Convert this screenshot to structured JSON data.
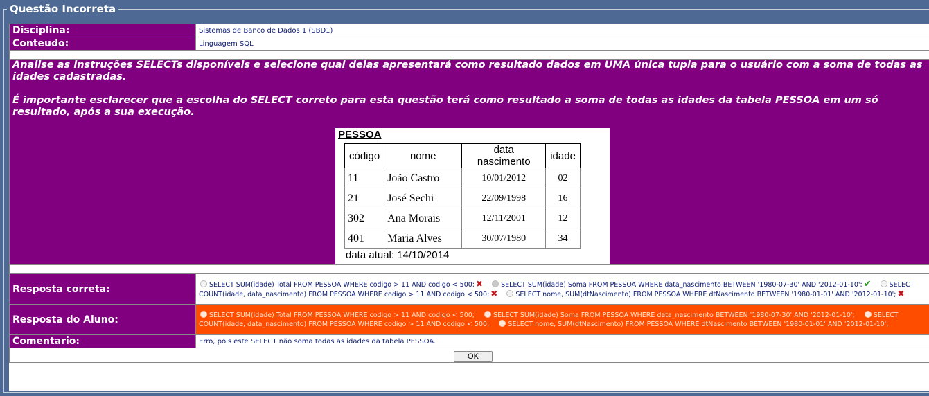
{
  "legend": "Questão Incorreta",
  "disciplina": {
    "label": "Disciplina:",
    "value": "Sistemas de Banco de Dados 1 (SBD1)"
  },
  "conteudo": {
    "label": "Conteudo:",
    "value": "Linguagem SQL"
  },
  "enunciado": {
    "p1": "Analise as instruções SELECTs disponíveis e selecione qual delas apresentará como resultado dados em UMA única tupla para o usuário com a soma de todas as idades cadastradas.",
    "p2": "É importante esclarecer que a escolha do SELECT correto para esta questão terá como resultado a soma de todas as idades da tabela PESSOA em um só resultado, após a sua execução."
  },
  "figura": {
    "titulo": "PESSOA",
    "headers": [
      "código",
      "nome",
      "data nascimento",
      "idade"
    ],
    "rows": [
      [
        "11",
        "João Castro",
        "10/01/2012",
        "02"
      ],
      [
        "21",
        "José Sechi",
        "22/09/1998",
        "16"
      ],
      [
        "302",
        "Ana Morais",
        "12/11/2001",
        "12"
      ],
      [
        "401",
        "Maria Alves",
        "30/07/1980",
        "34"
      ]
    ],
    "data_atual": "data atual: 14/10/2014"
  },
  "resposta_correta": {
    "label": "Resposta correta:",
    "options": [
      {
        "text": "SELECT SUM(idade) Total FROM PESSOA WHERE codigo > 11 AND codigo < 500;",
        "mark": "x",
        "selected": false
      },
      {
        "text": "SELECT SUM(idade) Soma FROM PESSOA WHERE data_nascimento BETWEEN '1980-07-30' AND '2012-01-10';",
        "mark": "check",
        "selected": true
      },
      {
        "text": "SELECT COUNT(idade, data_nascimento) FROM PESSOA WHERE codigo > 11 AND codigo < 500;",
        "mark": "x",
        "selected": false
      },
      {
        "text": "SELECT nome, SUM(dtNascimento) FROM PESSOA WHERE dtNascimento BETWEEN '1980-01-01' AND '2012-01-10';",
        "mark": "x",
        "selected": false
      }
    ]
  },
  "resposta_aluno": {
    "label": "Resposta do Aluno:",
    "options": [
      "SELECT SUM(idade) Total FROM PESSOA WHERE codigo > 11 AND codigo < 500;",
      "SELECT SUM(idade) Soma FROM PESSOA WHERE data_nascimento BETWEEN '1980-07-30' AND '2012-01-10';",
      "SELECT COUNT(idade, data_nascimento) FROM PESSOA WHERE codigo > 11 AND codigo < 500;",
      "SELECT nome, SUM(dtNascimento) FROM PESSOA WHERE dtNascimento BETWEEN '1980-01-01' AND '2012-01-10';"
    ]
  },
  "comentario": {
    "label": "Comentario:",
    "value": "Erro, pois este SELECT não soma todas as idades da tabela PESSOA."
  },
  "ok_button": "OK",
  "colors": {
    "purple": "#800080",
    "wrong_bg": "#ff4d00",
    "page_bg": "#4e6a94",
    "text_blue": "#10217a"
  }
}
